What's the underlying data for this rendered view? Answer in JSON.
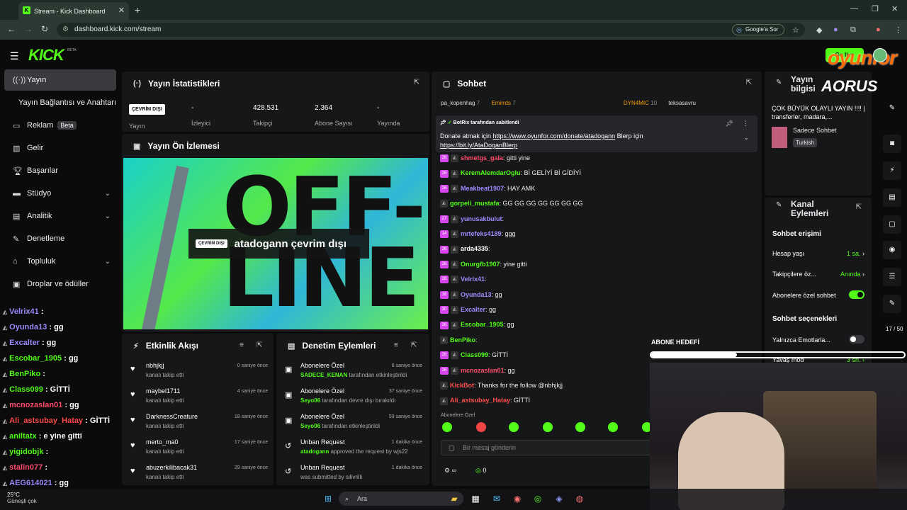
{
  "browser": {
    "tab_title": "Stream - Kick Dashboard",
    "url": "dashboard.kick.com/stream",
    "google_sor": "Google'a Sor"
  },
  "header": {
    "logo": "KICK",
    "beta": "BETA",
    "go_live": "Go live",
    "sponsor": "oyunfor"
  },
  "sidebar": {
    "items": [
      {
        "label": "Yayın",
        "icon": "broadcast-icon",
        "active": true
      },
      {
        "label": "Yayın Bağlantısı ve Anahtarı",
        "icon": "",
        "active": false
      },
      {
        "label": "Reklam",
        "icon": "ads-icon",
        "badge": "Beta"
      },
      {
        "label": "Gelir",
        "icon": "chart-icon"
      },
      {
        "label": "Başarılar",
        "icon": "trophy-icon"
      },
      {
        "label": "Stüdyo",
        "icon": "studio-icon",
        "chevron": true
      },
      {
        "label": "Analitik",
        "icon": "analytics-icon",
        "chevron": true
      },
      {
        "label": "Denetleme",
        "icon": "wrench-icon"
      },
      {
        "label": "Topluluk",
        "icon": "community-icon",
        "chevron": true
      },
      {
        "label": "Droplar ve ödüller",
        "icon": "gift-icon"
      }
    ]
  },
  "overlay_chat": [
    {
      "user": "Velrix41",
      "msg": ":",
      "color": "#9d8cff"
    },
    {
      "user": "Oyunda13",
      "msg": ": gg",
      "color": "#9d8cff"
    },
    {
      "user": "Excalter",
      "msg": ": gg",
      "color": "#9d8cff"
    },
    {
      "user": "Escobar_1905",
      "msg": ": gg",
      "color": "#53fc18"
    },
    {
      "user": "BenPiko",
      "msg": ":",
      "color": "#53fc18"
    },
    {
      "user": "Class099",
      "msg": ": GİTTİ",
      "color": "#53fc18"
    },
    {
      "user": "mcnozaslan01",
      "msg": ": gg",
      "color": "#ff4d6d"
    },
    {
      "user": "Ali_astsubay_Hatay",
      "msg": ": GİTTİ",
      "color": "#ff4d4d"
    },
    {
      "user": "aniltatx",
      "msg": ": e yine gitti",
      "color": "#53fc18"
    },
    {
      "user": "yigidobjk",
      "msg": ":",
      "color": "#53fc18"
    },
    {
      "user": "stalin077",
      "msg": ":",
      "color": "#ff4d6d"
    },
    {
      "user": "AEG614021",
      "msg": ": gg",
      "color": "#9d8cff"
    }
  ],
  "stats": {
    "title": "Yayın İstatistikleri",
    "status": "ÇEVRİM DIŞI",
    "status_label": "Yayın",
    "viewers": "-",
    "viewers_label": "İzleyici",
    "followers": "428.531",
    "followers_label": "Takipçi",
    "subs": "2.364",
    "subs_label": "Abone Sayısı",
    "duration": "-",
    "duration_label": "Yayında"
  },
  "preview": {
    "title": "Yayın Ön İzlemesi",
    "offline_badge": "ÇEVRİM DIŞI",
    "offline_text": "atadogann çevrim dışı",
    "bg_text": "OFF-\nLINE"
  },
  "activity": {
    "title": "Etkinlik Akışı",
    "items": [
      {
        "name": "nbhjkjj",
        "sub": "kanalı takip etti",
        "time": "0 saniye önce"
      },
      {
        "name": "maybel1711",
        "sub": "kanalı takip etti",
        "time": "4 saniye önce"
      },
      {
        "name": "DarknessCreature",
        "sub": "kanalı takip etti",
        "time": "18 saniye önce"
      },
      {
        "name": "merto_ma0",
        "sub": "kanalı takip etti",
        "time": "17 saniye önce"
      },
      {
        "name": "abuzerkilibacak31",
        "sub": "kanalı takip etti",
        "time": "29 saniye önce"
      }
    ]
  },
  "moderation": {
    "title": "Denetim Eylemleri",
    "items": [
      {
        "name": "Abonelere Özel",
        "user": "SADECE_KENAN",
        "sub": " tarafından etkinleştirildi",
        "time": "6 saniye önce"
      },
      {
        "name": "Abonelere Özel",
        "user": "Seyo06",
        "sub": " tarafından devre dışı bırakıldı",
        "time": "37 saniye önce"
      },
      {
        "name": "Abonelere Özel",
        "user": "Seyo06",
        "sub": " tarafından etkinleştirildi",
        "time": "59 saniye önce"
      },
      {
        "name": "Unban Request",
        "user": "atadogann",
        "sub": " approved the request by wjs22",
        "time": "1 dakika önce"
      },
      {
        "name": "Unban Request",
        "user": "",
        "sub": "was submitted by silivrilli",
        "time": "1 dakika önce"
      }
    ]
  },
  "chat": {
    "title": "Sohbet",
    "top_gifters": [
      {
        "name": "pa_kopenhag",
        "count": "7"
      },
      {
        "name": "Emirrds",
        "count": "7"
      },
      {
        "name": "DYN4MIC",
        "count": "10"
      },
      {
        "name": "teksasavru",
        "count": ""
      }
    ],
    "pinned_header": "BotRix tarafından sabitlendi",
    "pinned_pre": "Donate atmak için ",
    "pinned_link1": "https://www.oyunfor.com/donate/atadogann",
    "pinned_mid": " Blerp için",
    "pinned_link2": "https://bit.ly/AtaDoganBlerp",
    "messages": [
      {
        "badge": "26",
        "user": "shmetgs_gala",
        "msg": ": gitti yine",
        "color": "#ff4d6d"
      },
      {
        "badge": "26",
        "user": "KeremAlemdarOglu",
        "msg": ": Bİ GELİYİ Bİ GİDİYİ",
        "color": "#53fc18"
      },
      {
        "badge": "26",
        "user": "Meakbeat1907",
        "msg": ": HAY AMK",
        "color": "#9d8cff"
      },
      {
        "badge": "",
        "user": "gorpeli_mustafa",
        "msg": ": GG GG GG GG GG GG GG",
        "color": "#53fc18"
      },
      {
        "badge": "27",
        "user": "yunusakbulut",
        "msg": ":",
        "color": "#9d8cff"
      },
      {
        "badge": "14",
        "user": "mrtefeks4189",
        "msg": ": ggg",
        "color": "#9d8cff"
      },
      {
        "badge": "26",
        "user": "arda4335",
        "msg": ":",
        "color": "#ffffff"
      },
      {
        "badge": "26",
        "user": "Onurgfb1907",
        "msg": ": yine gitti",
        "color": "#53fc18"
      },
      {
        "badge": "28",
        "user": "Velrix41",
        "msg": ":",
        "color": "#9d8cff"
      },
      {
        "badge": "16",
        "user": "Oyunda13",
        "msg": ": gg",
        "color": "#9d8cff"
      },
      {
        "badge": "30",
        "user": "Excalter",
        "msg": ": gg",
        "color": "#9d8cff"
      },
      {
        "badge": "26",
        "user": "Escobar_1905",
        "msg": ": gg",
        "color": "#53fc18"
      },
      {
        "badge": "",
        "user": "BenPiko",
        "msg": ":",
        "color": "#53fc18"
      },
      {
        "badge": "26",
        "user": "Class099",
        "msg": ": GİTTİ",
        "color": "#53fc18"
      },
      {
        "badge": "26",
        "user": "mcnozaslan01",
        "msg": ": gg",
        "color": "#ff4d6d"
      },
      {
        "badge": "",
        "user": "KickBot",
        "msg": ": Thanks for the follow @nbhjkjj",
        "color": "#ff4d4d"
      },
      {
        "badge": "",
        "user": "Ali_astsubay_Hatay",
        "msg": ": GİTTİ",
        "color": "#ff4d4d"
      }
    ],
    "sub_only_label": "Abonelere Özel",
    "input_placeholder": "Bir mesaj gönderin",
    "counter": "0"
  },
  "info": {
    "title": "Yayın bilgisi",
    "stream_title": "ÇOK BÜYÜK OLAYLI YAYIN !!!! | transferler, madara,...",
    "category": "Sadece Sohbet",
    "tag": "Turkish",
    "sponsor": "AORUS"
  },
  "kanal": {
    "title": "Kanal Eylemleri",
    "chat_access": "Sohbet erişimi",
    "account_age": "Hesap yaşı",
    "account_age_val": "1 sa.",
    "followers_only": "Takipçilere öz...",
    "followers_only_val": "Anında",
    "subs_only": "Abonelere özel sohbet",
    "chat_options": "Sohbet seçenekleri",
    "emotes_only": "Yalnızca Emotlarla...",
    "slow_mode": "Yavaş mod",
    "slow_mode_val": "3 sn."
  },
  "overlay": {
    "abone_hedefi": "ABONE HEDEFİ",
    "sub_goal": "17 / 50"
  },
  "taskbar": {
    "search": "Ara",
    "weather": "25°C",
    "weather_sub": "Güneşli çok"
  }
}
